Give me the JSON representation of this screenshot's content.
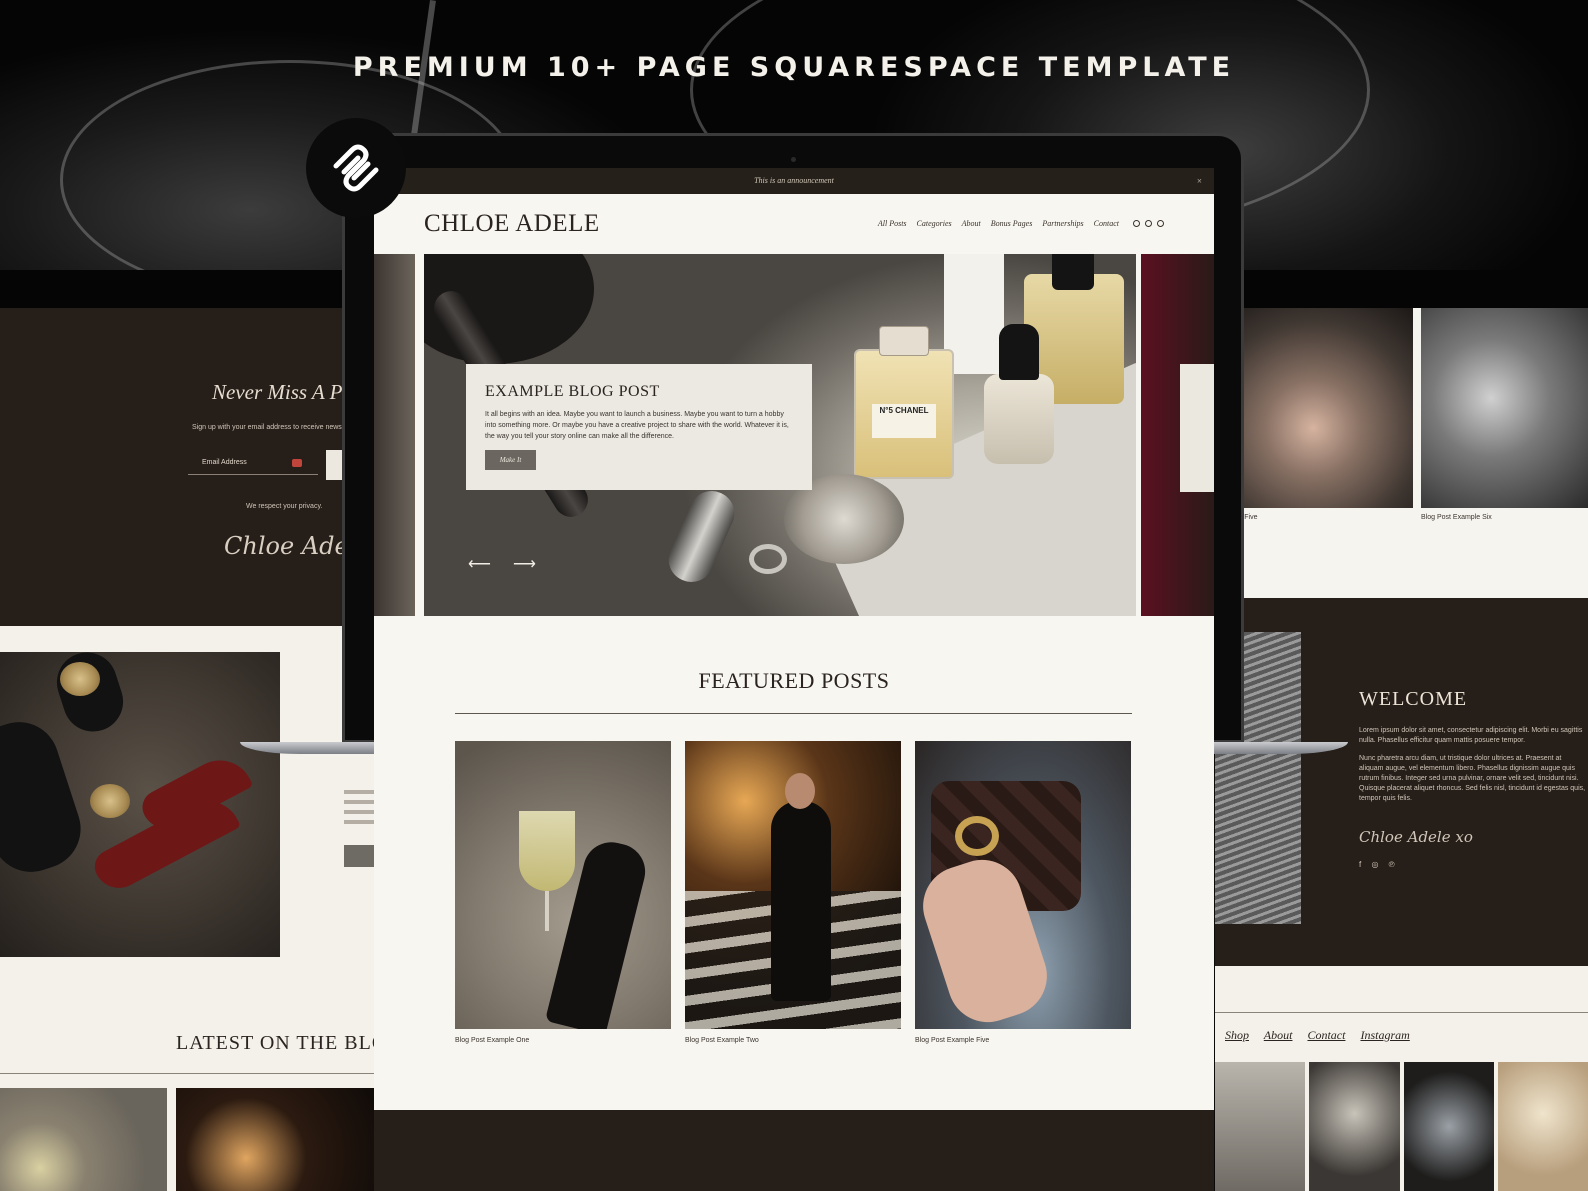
{
  "headline": "PREMIUM 10+ PAGE SQUARESPACE TEMPLATE",
  "colors": {
    "dark": "#261e18",
    "cream": "#f8f6f0",
    "accent_red": "#c2453b"
  },
  "left_page": {
    "newsletter_title": "Never Miss A Pos",
    "newsletter_sub": "Sign up with your email address to receive news ar",
    "email_placeholder": "Email Address",
    "privacy": "We respect your privacy.",
    "signature": "Chloe Adele xo",
    "latest_title": "LATEST ON THE BLO"
  },
  "right_page": {
    "caption_a": "ple Five",
    "caption_b": "Blog Post Example Six",
    "welcome_title": "WELCOME",
    "welcome_p1": "Lorem ipsum dolor sit amet, consectetur adipiscing elit. Morbi eu sagittis nulla. Phasellus efficitur quam mattis posuere tempor.",
    "welcome_p2": "Nunc pharetra arcu diam, ut tristique dolor ultrices at. Praesent at aliquam augue, vel elementum libero. Phasellus dignissim augue quis rutrum finibus. Integer sed urna pulvinar, ornare velit sed, tincidunt nisi. Quisque placerat aliquet rhoncus. Sed felis nisl, tincidunt id egestas quis, tempor quis felis.",
    "signature": "Chloe Adele xo",
    "footer_nav": [
      "Shop",
      "About",
      "Contact",
      "Instagram"
    ]
  },
  "site": {
    "announcement": "This is an announcement",
    "logo": "CHLOE ADELE",
    "nav": [
      "All Posts",
      "Categories",
      "About",
      "Bonus Pages",
      "Partnerships",
      "Contact"
    ],
    "hero": {
      "title": "EXAMPLE BLOG POST",
      "body": "It all begins with an idea. Maybe you want to launch a business. Maybe you want to turn a hobby into something more. Or maybe you have a creative project to share with the world. Whatever it is, the way you tell your story online can make all the difference.",
      "button": "Make It",
      "bottle_label": "N°5 CHANEL",
      "prev_arrow": "⟵",
      "next_arrow": "⟶"
    },
    "featured_title": "FEATURED POSTS",
    "posts": [
      {
        "caption": "Blog Post Example One"
      },
      {
        "caption": "Blog Post Example Two"
      },
      {
        "caption": "Blog Post Example Five"
      }
    ]
  }
}
